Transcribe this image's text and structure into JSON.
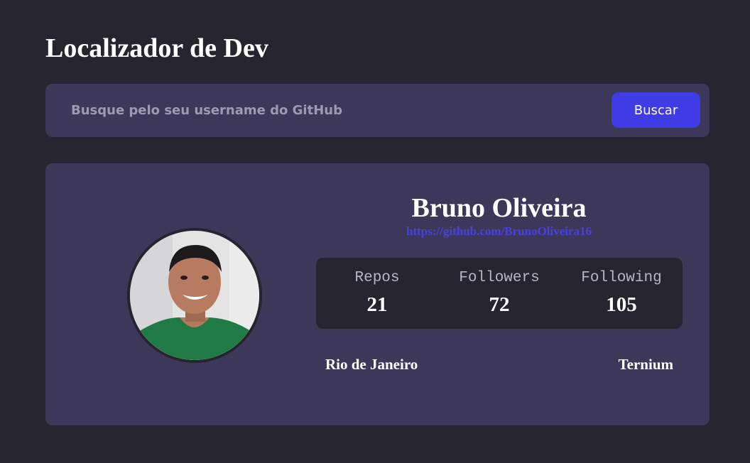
{
  "app": {
    "title": "Localizador de Dev"
  },
  "search": {
    "placeholder": "Busque pelo seu username do GitHub",
    "value": "",
    "button_label": "Buscar"
  },
  "profile": {
    "name": "Bruno Oliveira",
    "url": "https://github.com/BrunoOliveira16",
    "location": "Rio de Janeiro",
    "company": "Ternium",
    "stats": [
      {
        "label": "Repos",
        "value": "21"
      },
      {
        "label": "Followers",
        "value": "72"
      },
      {
        "label": "Following",
        "value": "105"
      }
    ]
  },
  "colors": {
    "background": "#26242f",
    "panel": "#3d385a",
    "accent": "#3f3be5",
    "link": "#4a3fe0"
  }
}
